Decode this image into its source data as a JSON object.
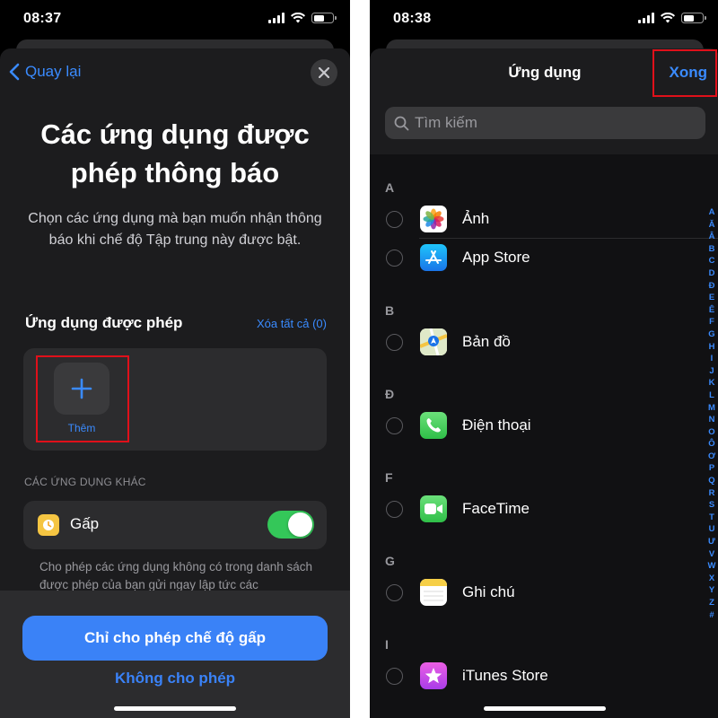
{
  "left": {
    "status": {
      "time": "08:37"
    },
    "back_label": "Quay lại",
    "title": "Các ứng dụng được phép thông báo",
    "description": "Chọn các ứng dụng mà bạn muốn nhận thông báo khi chế độ Tập trung này được bật.",
    "allowed_section_title": "Ứng dụng được phép",
    "clear_all_label": "Xóa tất cả (0)",
    "add_label": "Thêm",
    "other_apps_header": "CÁC ỨNG DỤNG KHÁC",
    "urgent_label": "Gấp",
    "urgent_toggle_on": true,
    "footnote": "Cho phép các ứng dụng không có trong danh sách được phép của bạn gửi ngay lập tức các",
    "primary_button": "Chỉ cho phép chế độ gấp",
    "secondary_button": "Không cho phép"
  },
  "right": {
    "status": {
      "time": "08:38"
    },
    "nav_title": "Ứng dụng",
    "done_label": "Xong",
    "search_placeholder": "Tìm kiếm",
    "sections": [
      {
        "letter": "A",
        "apps": [
          {
            "name": "Ảnh",
            "icon": "photos-icon"
          },
          {
            "name": "App Store",
            "icon": "app-store-icon"
          }
        ]
      },
      {
        "letter": "B",
        "apps": [
          {
            "name": "Bản đồ",
            "icon": "maps-icon"
          }
        ]
      },
      {
        "letter": "Đ",
        "apps": [
          {
            "name": "Điện thoại",
            "icon": "phone-icon"
          }
        ]
      },
      {
        "letter": "F",
        "apps": [
          {
            "name": "FaceTime",
            "icon": "facetime-icon"
          }
        ]
      },
      {
        "letter": "G",
        "apps": [
          {
            "name": "Ghi chú",
            "icon": "notes-icon"
          }
        ]
      },
      {
        "letter": "I",
        "apps": [
          {
            "name": "iTunes Store",
            "icon": "itunes-store-icon"
          }
        ]
      }
    ],
    "index_letters": [
      "A",
      "Ă",
      "Â",
      "B",
      "C",
      "D",
      "Đ",
      "E",
      "Ê",
      "F",
      "G",
      "H",
      "I",
      "J",
      "K",
      "L",
      "M",
      "N",
      "O",
      "Ô",
      "Ơ",
      "P",
      "Q",
      "R",
      "S",
      "T",
      "U",
      "Ư",
      "V",
      "W",
      "X",
      "Y",
      "Z",
      "#"
    ]
  },
  "colors": {
    "accent": "#3a8bff",
    "primary_button": "#3a82f7",
    "toggle_on": "#34c759",
    "highlight_box": "#e0101a"
  }
}
